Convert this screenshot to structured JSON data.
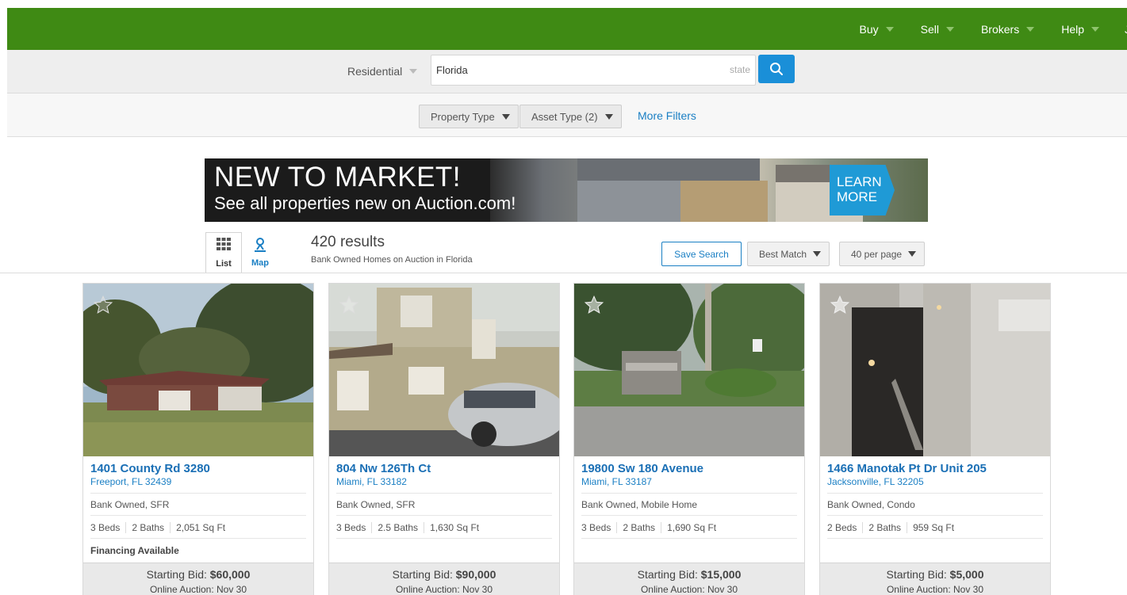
{
  "nav": {
    "items": [
      "Buy",
      "Sell",
      "Brokers",
      "Help"
    ],
    "cut_item": "J"
  },
  "search": {
    "category": "Residential",
    "query": "Florida",
    "hint": "state"
  },
  "filters": {
    "property_type": "Property Type",
    "asset_type": "Asset Type (2)",
    "more": "More Filters"
  },
  "banner": {
    "headline": "NEW TO MARKET!",
    "subline": "See all properties new on Auction.com!",
    "cta_line1": "LEARN",
    "cta_line2": "MORE"
  },
  "results": {
    "tab_list": "List",
    "tab_map": "Map",
    "count": "420 results",
    "description": "Bank Owned Homes on Auction in Florida",
    "save_search": "Save Search",
    "sort": "Best Match",
    "per_page": "40 per page"
  },
  "bid_label": "Starting Bid:",
  "listings": [
    {
      "address": "1401 County Rd 3280",
      "city": "Freeport, FL 32439",
      "type": "Bank Owned, SFR",
      "beds": "3 Beds",
      "baths": "2 Baths",
      "sqft": "2,051 Sq Ft",
      "financing": "Financing Available",
      "bid": "$60,000",
      "auction": "Online Auction: Nov 30"
    },
    {
      "address": "804 Nw 126Th Ct",
      "city": "Miami, FL 33182",
      "type": "Bank Owned, SFR",
      "beds": "3 Beds",
      "baths": "2.5 Baths",
      "sqft": "1,630 Sq Ft",
      "financing": "",
      "bid": "$90,000",
      "auction": "Online Auction: Nov 30"
    },
    {
      "address": "19800 Sw 180 Avenue",
      "city": "Miami, FL 33187",
      "type": "Bank Owned, Mobile Home",
      "beds": "3 Beds",
      "baths": "2 Baths",
      "sqft": "1,690 Sq Ft",
      "financing": "",
      "bid": "$15,000",
      "auction": "Online Auction: Nov 30"
    },
    {
      "address": "1466 Manotak Pt Dr Unit 205",
      "city": "Jacksonville, FL 32205",
      "type": "Bank Owned, Condo",
      "beds": "2 Beds",
      "baths": "2 Baths",
      "sqft": "959 Sq Ft",
      "financing": "",
      "bid": "$5,000",
      "auction": "Online Auction: Nov 30"
    }
  ],
  "colors": {
    "brand_green": "#3f8a14",
    "link_blue": "#1a7fc4",
    "search_button": "#1a8fd8"
  }
}
